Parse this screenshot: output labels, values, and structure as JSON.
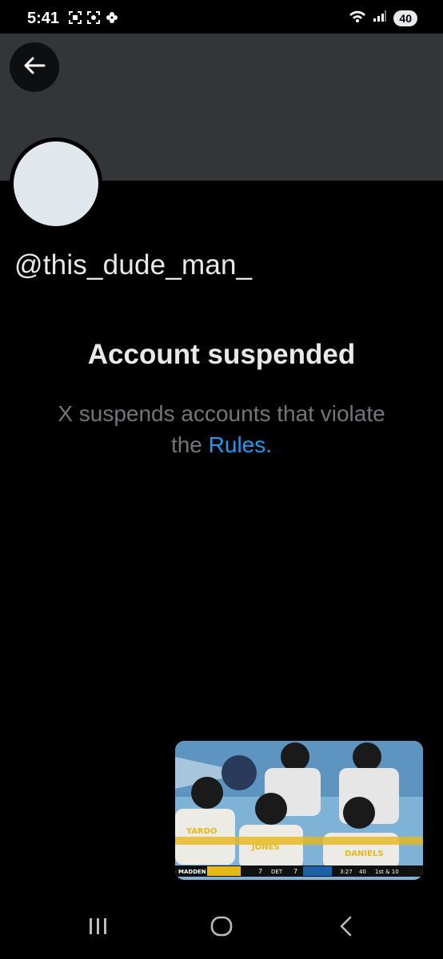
{
  "status_bar": {
    "time": "5:41",
    "battery": "40"
  },
  "profile": {
    "handle": "@this_dude_man_"
  },
  "suspension": {
    "title": "Account suspended",
    "message_before_link": "X suspends accounts that violate the ",
    "link_label": "Rules",
    "message_after_link": "."
  },
  "video_overlay": {
    "players": [
      "YARDO",
      "JONES",
      "DANIELS"
    ],
    "scoreboard": {
      "brand": "MADDEN",
      "team1_score": "7",
      "team2_abbr": "DET",
      "team2_score": "7",
      "clock": "3:27",
      "play_clock": "40",
      "down": "1st & 10"
    }
  },
  "colors": {
    "background": "#000000",
    "banner": "#333639",
    "link": "#1d9bf0",
    "muted_text": "#71767b"
  }
}
